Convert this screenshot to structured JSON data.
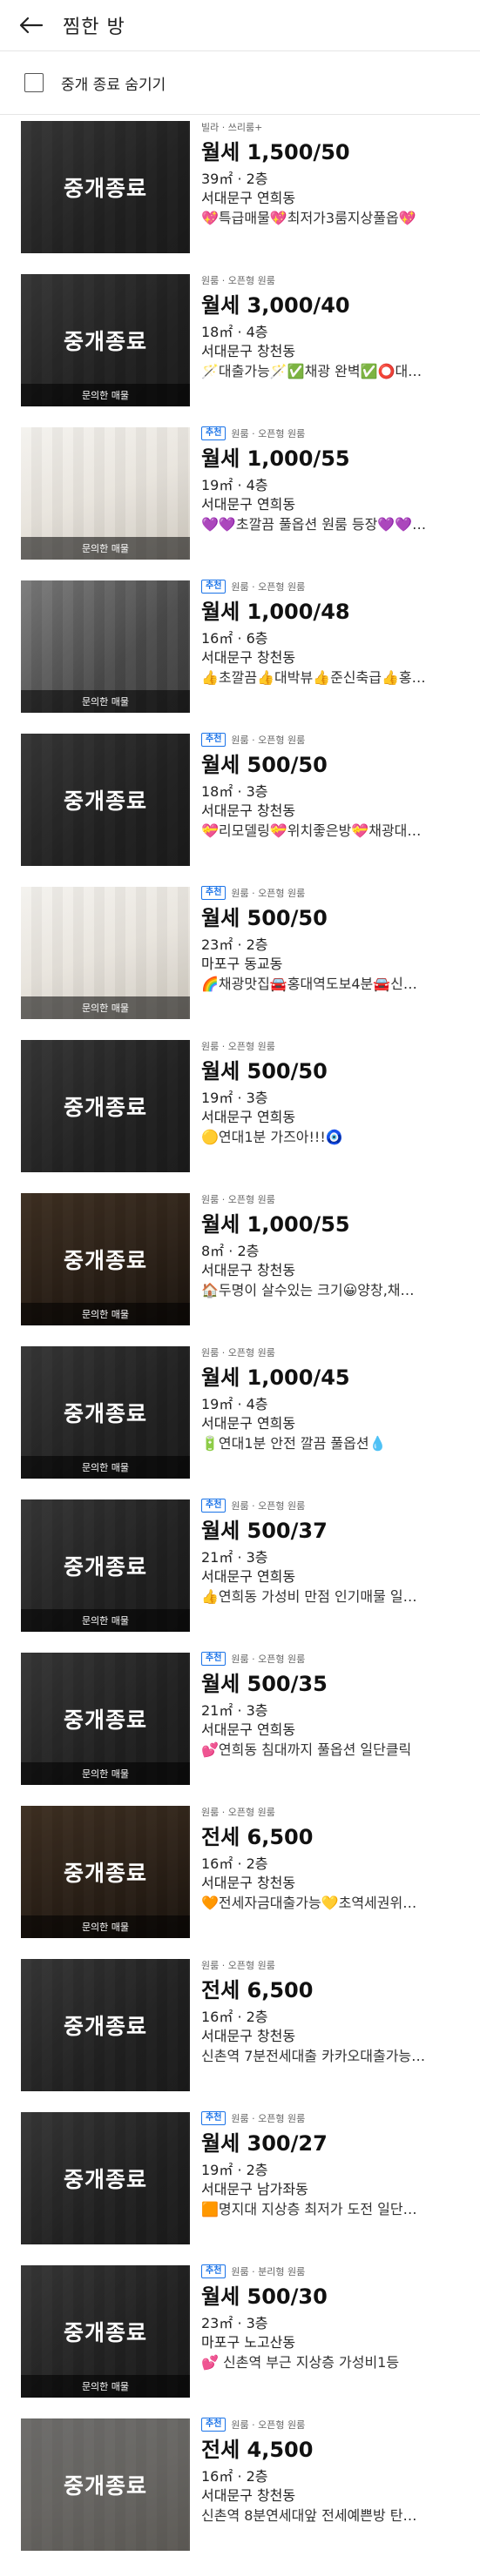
{
  "header": {
    "title": "찜한 방",
    "back_icon": "arrow-left-icon"
  },
  "filter": {
    "label": "중개 종료 숨기기",
    "checked": false
  },
  "labels": {
    "ended": "중개종료",
    "inquired": "문의한 매물",
    "recommend": "추천"
  },
  "items": [
    {
      "thumb": "dark",
      "ended": true,
      "inquired": false,
      "recommended": false,
      "type": "빌라 · 쓰리룸+",
      "price": "월세 1,500/50",
      "size": "39㎡ · 2층",
      "location": "서대문구 연희동",
      "desc": "💖특급매물💖최저가3룸지상풀옵💖"
    },
    {
      "thumb": "dark",
      "ended": true,
      "inquired": true,
      "recommended": false,
      "type": "원룸 · 오픈형 원룸",
      "price": "월세 3,000/40",
      "size": "18㎡ · 4층",
      "location": "서대문구 창천동",
      "desc": "🪄대출가능🪄✅채광 완벽✅⭕대…"
    },
    {
      "thumb": "light",
      "ended": false,
      "inquired": true,
      "recommended": true,
      "type": "원룸 · 오픈형 원룸",
      "price": "월세 1,000/55",
      "size": "19㎡ · 4층",
      "location": "서대문구 연희동",
      "desc": "💜💜초깔끔 풀옵션 원룸 등장💜💜…"
    },
    {
      "thumb": "dark",
      "ended": false,
      "inquired": true,
      "recommended": true,
      "type": "원룸 · 오픈형 원룸",
      "price": "월세 1,000/48",
      "size": "16㎡ · 6층",
      "location": "서대문구 창천동",
      "desc": "👍초깔끔👍대박뷰👍준신축급👍홍…"
    },
    {
      "thumb": "dark",
      "ended": true,
      "inquired": false,
      "recommended": true,
      "type": "원룸 · 오픈형 원룸",
      "price": "월세 500/50",
      "size": "18㎡ · 3층",
      "location": "서대문구 창천동",
      "desc": "💝리모델링💝위치좋은방💝채광대…"
    },
    {
      "thumb": "light",
      "ended": false,
      "inquired": true,
      "recommended": true,
      "type": "원룸 · 오픈형 원룸",
      "price": "월세 500/50",
      "size": "23㎡ · 2층",
      "location": "마포구 동교동",
      "desc": "🌈채광맛집🚘홍대역도보4분🚘신…"
    },
    {
      "thumb": "dark",
      "ended": true,
      "inquired": false,
      "recommended": false,
      "type": "원룸 · 오픈형 원룸",
      "price": "월세 500/50",
      "size": "19㎡ · 3층",
      "location": "서대문구 연희동",
      "desc": "🟡연대1분 가즈아!!!🧿"
    },
    {
      "thumb": "wood",
      "ended": true,
      "inquired": true,
      "recommended": false,
      "type": "원룸 · 오픈형 원룸",
      "price": "월세 1,000/55",
      "size": "8㎡ · 2층",
      "location": "서대문구 창천동",
      "desc": "🏠두명이 살수있는 크기😀양창,채…"
    },
    {
      "thumb": "dark",
      "ended": true,
      "inquired": true,
      "recommended": false,
      "type": "원룸 · 오픈형 원룸",
      "price": "월세 1,000/45",
      "size": "19㎡ · 4층",
      "location": "서대문구 연희동",
      "desc": "🔋연대1분 안전 깔끔 풀옵션💧"
    },
    {
      "thumb": "dark",
      "ended": true,
      "inquired": true,
      "recommended": true,
      "type": "원룸 · 오픈형 원룸",
      "price": "월세 500/37",
      "size": "21㎡ · 3층",
      "location": "서대문구 연희동",
      "desc": "👍연희동 가성비 만점 인기매물 일…"
    },
    {
      "thumb": "dark",
      "ended": true,
      "inquired": true,
      "recommended": true,
      "type": "원룸 · 오픈형 원룸",
      "price": "월세 500/35",
      "size": "21㎡ · 3층",
      "location": "서대문구 연희동",
      "desc": "💕연희동 침대까지 풀옵션 일단클릭"
    },
    {
      "thumb": "wood",
      "ended": true,
      "inquired": true,
      "recommended": false,
      "type": "원룸 · 오픈형 원룸",
      "price": "전세 6,500",
      "size": "16㎡ · 2층",
      "location": "서대문구 창천동",
      "desc": "🧡전세자금대출가능💛초역세권위…"
    },
    {
      "thumb": "dark",
      "ended": true,
      "inquired": false,
      "recommended": false,
      "type": "원룸 · 오픈형 원룸",
      "price": "전세 6,500",
      "size": "16㎡ · 2층",
      "location": "서대문구 창천동",
      "desc": "신촌역 7분전세대출 카카오대출가능…"
    },
    {
      "thumb": "dark",
      "ended": true,
      "inquired": false,
      "recommended": true,
      "type": "원룸 · 오픈형 원룸",
      "price": "월세 300/27",
      "size": "19㎡ · 2층",
      "location": "서대문구 남가좌동",
      "desc": "🟧명지대 지상층 최저가 도전 일단…"
    },
    {
      "thumb": "dark",
      "ended": true,
      "inquired": true,
      "recommended": true,
      "type": "원룸 · 분리형 원룸",
      "price": "월세 500/30",
      "size": "23㎡ · 3층",
      "location": "마포구 노고산동",
      "desc": "💕 신촌역 부근 지상층 가성비1등"
    },
    {
      "thumb": "light",
      "ended": true,
      "inquired": false,
      "recommended": true,
      "type": "원룸 · 오픈형 원룸",
      "price": "전세 4,500",
      "size": "16㎡ · 2층",
      "location": "서대문구 창천동",
      "desc": "신촌역 8분연세대앞 전세예쁜방 탄…"
    }
  ]
}
